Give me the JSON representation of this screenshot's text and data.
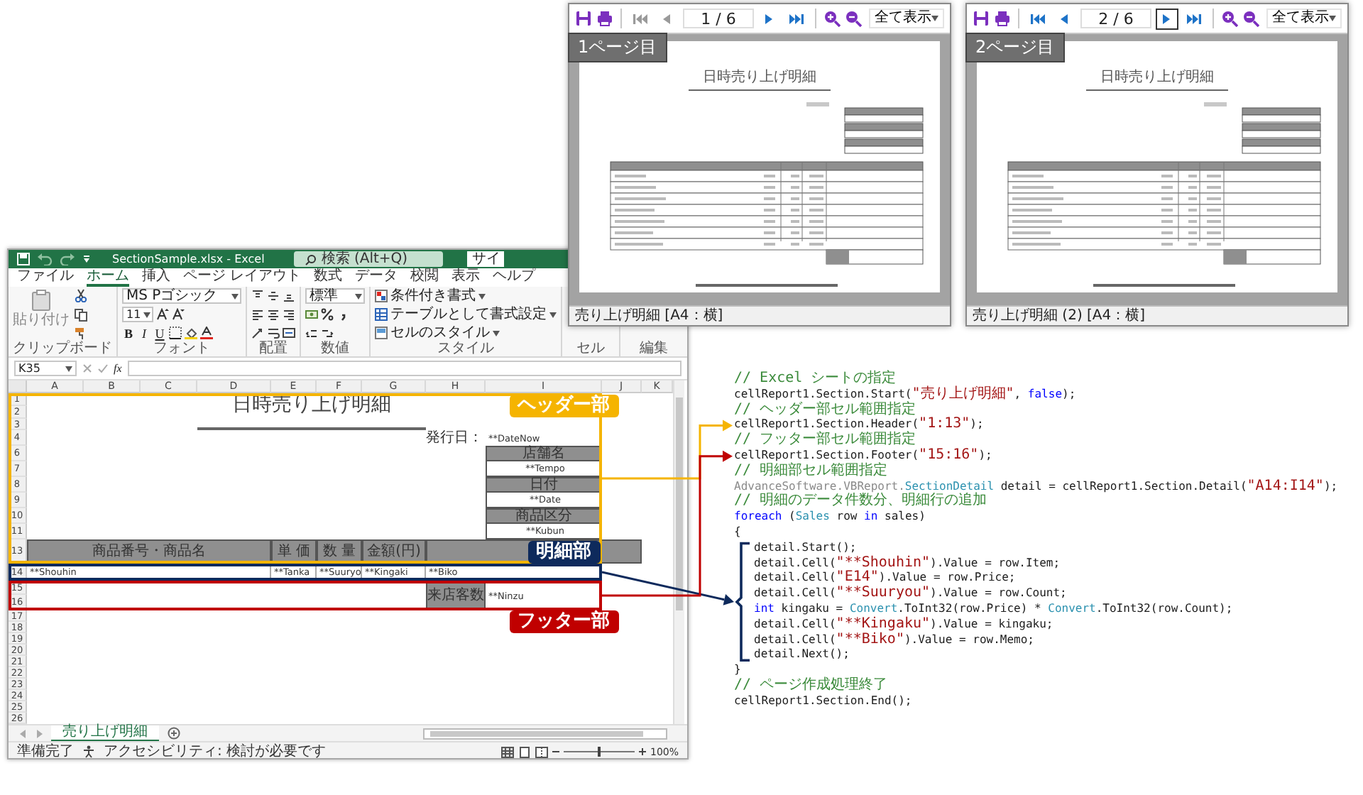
{
  "excel": {
    "title": "SectionSample.xlsx - Excel",
    "search": {
      "placeholder": "検索 (Alt+Q)"
    },
    "sign_in": "サイ",
    "ribbon_tabs": [
      {
        "label": "ファイル",
        "selected": false
      },
      {
        "label": "ホーム",
        "selected": true
      },
      {
        "label": "挿入",
        "selected": false
      },
      {
        "label": "ページ レイアウト",
        "selected": false
      },
      {
        "label": "数式",
        "selected": false
      },
      {
        "label": "データ",
        "selected": false
      },
      {
        "label": "校閲",
        "selected": false
      },
      {
        "label": "表示",
        "selected": false
      },
      {
        "label": "ヘルプ",
        "selected": false
      }
    ],
    "ribbon": {
      "paste": "貼り付け",
      "font_name": "MS Pゴシック",
      "font_size": "11",
      "format_buttons": [
        "B",
        "I",
        "U"
      ],
      "number_format": "標準",
      "style_commands": [
        "条件付き書式",
        "テーブルとして書式設定",
        "セルのスタイル"
      ],
      "group_labels": [
        "クリップボード",
        "フォント",
        "配置",
        "数値",
        "スタイル",
        "セル",
        "編集"
      ]
    },
    "name_box": "K35",
    "function_label": "fx",
    "columns": [
      "A",
      "B",
      "C",
      "D",
      "E",
      "F",
      "G",
      "H",
      "I",
      "J",
      "K"
    ],
    "row_numbers": [
      "1",
      "2",
      "3",
      "4",
      "6",
      "7",
      "8",
      "9",
      "10",
      "11",
      "13",
      "14",
      "15",
      "16",
      "17",
      "18",
      "19",
      "20",
      "21",
      "22",
      "23",
      "24",
      "25",
      "26"
    ],
    "sheet": {
      "title": "日時売り上げ明細",
      "issue_label": "発行日：",
      "issue_value": "**DateNow",
      "info_box": [
        {
          "label": "店舗名",
          "value": "**Tempo"
        },
        {
          "label": "日付",
          "value": "**Date"
        },
        {
          "label": "商品区分",
          "value": "**Kubun"
        }
      ],
      "detail_headers": [
        "商品番号・商品名",
        "単 価",
        "数 量",
        "金額(円)"
      ],
      "detail_fields": [
        "**Shouhin",
        "**Tanka",
        "**Suuryo",
        "**Kingaki",
        "**Biko"
      ],
      "footer_label": "来店客数",
      "footer_value": "**Ninzu"
    },
    "sections": [
      {
        "kind": "header",
        "label": "ヘッダー部",
        "color": "#f5b400"
      },
      {
        "kind": "detail",
        "label": "明細部",
        "color": "#0e2a5c"
      },
      {
        "kind": "footer",
        "label": "フッター部",
        "color": "#c00000"
      }
    ],
    "sheet_tab": {
      "label": "売り上げ明細",
      "selected": true
    },
    "status_bar": {
      "ready": "準備完了",
      "accessibility": "アクセシビリティ: 検討が必要です",
      "zoom_slider": {
        "level": 0.5
      },
      "zoom": "100%"
    }
  },
  "previews": [
    {
      "page_field": "1 / 6",
      "nav_buttons": [
        {
          "kind": "first",
          "disabled": true,
          "focused": false
        },
        {
          "kind": "prev",
          "disabled": true,
          "focused": false
        },
        {
          "kind": "next",
          "disabled": false,
          "focused": false
        },
        {
          "kind": "last",
          "disabled": false,
          "focused": false
        }
      ],
      "zoom": "全て表示",
      "page_label": "1ページ目",
      "report_title": "日時売り上げ明細",
      "status": "売り上げ明細 [A4：横]"
    },
    {
      "page_field": "2 / 6",
      "nav_buttons": [
        {
          "kind": "first",
          "disabled": false,
          "focused": false
        },
        {
          "kind": "prev",
          "disabled": false,
          "focused": false
        },
        {
          "kind": "next",
          "disabled": false,
          "focused": true
        },
        {
          "kind": "last",
          "disabled": false,
          "focused": false
        }
      ],
      "zoom": "全て表示",
      "page_label": "2ページ目",
      "report_title": "日時売り上げ明細",
      "status": "売り上げ明細 (2) [A4：横]"
    }
  ],
  "code": [
    {
      "tokens": [
        {
          "kind": "comment",
          "text": "// Excel シートの指定"
        }
      ]
    },
    {
      "tokens": [
        {
          "kind": "plain",
          "text": "cellReport1.Section.Start("
        },
        {
          "kind": "string",
          "text": "\"売り上げ明細\""
        },
        {
          "kind": "plain",
          "text": ", "
        },
        {
          "kind": "keyword",
          "text": "false"
        },
        {
          "kind": "plain",
          "text": ");"
        }
      ]
    },
    {
      "tokens": [
        {
          "kind": "comment",
          "text": "// ヘッダー部セル範囲指定"
        }
      ]
    },
    {
      "kind": "header",
      "tokens": [
        {
          "kind": "plain",
          "text": "cellReport1.Section.Header("
        },
        {
          "kind": "string",
          "text": "\"1:13\""
        },
        {
          "kind": "plain",
          "text": ");"
        }
      ]
    },
    {
      "tokens": [
        {
          "kind": "comment",
          "text": "// フッター部セル範囲指定"
        }
      ]
    },
    {
      "kind": "footer",
      "tokens": [
        {
          "kind": "plain",
          "text": "cellReport1.Section.Footer("
        },
        {
          "kind": "string",
          "text": "\"15:16\""
        },
        {
          "kind": "plain",
          "text": ");"
        }
      ]
    },
    {
      "tokens": [
        {
          "kind": "comment",
          "text": "// 明細部セル範囲指定"
        }
      ]
    },
    {
      "tokens": [
        {
          "kind": "namespace",
          "text": "AdvanceSoftware.VBReport."
        },
        {
          "kind": "type",
          "text": "SectionDetail"
        },
        {
          "kind": "plain",
          "text": " detail = cellReport1.Section.Detail("
        },
        {
          "kind": "string",
          "text": "\"A14:I14\""
        },
        {
          "kind": "plain",
          "text": ");"
        }
      ]
    },
    {
      "tokens": [
        {
          "kind": "comment",
          "text": "// 明細のデータ件数分、明細行の追加"
        }
      ]
    },
    {
      "tokens": [
        {
          "kind": "keyword",
          "text": "foreach"
        },
        {
          "kind": "plain",
          "text": " ("
        },
        {
          "kind": "type",
          "text": "Sales"
        },
        {
          "kind": "plain",
          "text": " row "
        },
        {
          "kind": "keyword",
          "text": "in"
        },
        {
          "kind": "plain",
          "text": " sales)"
        }
      ]
    },
    {
      "tokens": [
        {
          "kind": "plain",
          "text": "{"
        }
      ]
    },
    {
      "kind": "detail",
      "tokens": [
        {
          "kind": "plain",
          "text": "detail.Start();"
        }
      ]
    },
    {
      "kind": "detail",
      "tokens": [
        {
          "kind": "plain",
          "text": "detail.Cell("
        },
        {
          "kind": "string",
          "text": "\"**Shouhin\""
        },
        {
          "kind": "plain",
          "text": ").Value = row.Item;"
        }
      ]
    },
    {
      "kind": "detail",
      "tokens": [
        {
          "kind": "plain",
          "text": "detail.Cell("
        },
        {
          "kind": "string",
          "text": "\"E14\""
        },
        {
          "kind": "plain",
          "text": ").Value = row.Price;"
        }
      ]
    },
    {
      "kind": "detail",
      "tokens": [
        {
          "kind": "plain",
          "text": "detail.Cell("
        },
        {
          "kind": "string",
          "text": "\"**Suuryou\""
        },
        {
          "kind": "plain",
          "text": ").Value = row.Count;"
        }
      ]
    },
    {
      "kind": "detail",
      "tokens": [
        {
          "kind": "keyword",
          "text": "int"
        },
        {
          "kind": "plain",
          "text": " kingaku = "
        },
        {
          "kind": "type",
          "text": "Convert"
        },
        {
          "kind": "plain",
          "text": ".ToInt32(row.Price) * "
        },
        {
          "kind": "type",
          "text": "Convert"
        },
        {
          "kind": "plain",
          "text": ".ToInt32(row.Count);"
        }
      ]
    },
    {
      "kind": "detail",
      "tokens": [
        {
          "kind": "plain",
          "text": "detail.Cell("
        },
        {
          "kind": "string",
          "text": "\"**Kingaku\""
        },
        {
          "kind": "plain",
          "text": ").Value = kingaku;"
        }
      ]
    },
    {
      "kind": "detail",
      "tokens": [
        {
          "kind": "plain",
          "text": "detail.Cell("
        },
        {
          "kind": "string",
          "text": "\"**Biko\""
        },
        {
          "kind": "plain",
          "text": ").Value = row.Memo;"
        }
      ]
    },
    {
      "kind": "detail",
      "tokens": [
        {
          "kind": "plain",
          "text": "detail.Next();"
        }
      ]
    },
    {
      "tokens": [
        {
          "kind": "plain",
          "text": "}"
        }
      ]
    },
    {
      "tokens": [
        {
          "kind": "comment",
          "text": "// ページ作成処理終了"
        }
      ]
    },
    {
      "tokens": [
        {
          "kind": "plain",
          "text": "cellReport1.Section.End();"
        }
      ]
    }
  ]
}
